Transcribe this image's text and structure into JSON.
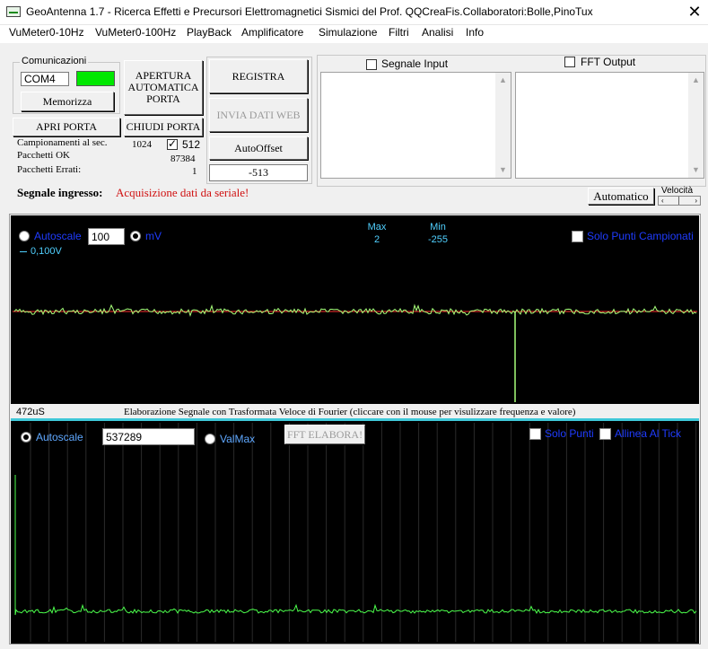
{
  "window": {
    "title": "GeoAntenna 1.7 - Ricerca Effetti e Precursori Elettromagnetici Sismici del Prof. QQCreaFis.Collaboratori:Bolle,PinoTux",
    "close_glyph": "✕"
  },
  "menu": [
    "VuMeter0-10Hz",
    "VuMeter0-100Hz",
    "PlayBack",
    "Amplificatore",
    "Simulazione",
    "Filtri",
    "Analisi",
    "Info"
  ],
  "comunicazioni": {
    "group_label": "Comunicazioni",
    "port_value": "COM4",
    "status_color": "#00e800",
    "memorizza_label": "Memorizza",
    "apri_porta_label": "APRI PORTA",
    "chiudi_porta_label": "CHIUDI PORTA",
    "apertura_line1": "APERTURA",
    "apertura_line2": "AUTOMATICA",
    "apertura_line3": "PORTA"
  },
  "stats": {
    "campionamenti_label": "Campionamenti al sec.",
    "campionamenti_value": "1024",
    "campionamenti_alt": "512",
    "pacchetti_ok_label": "Pacchetti OK",
    "pacchetti_ok_value": "87384",
    "pacchetti_errati_label": "Pacchetti Errati:",
    "pacchetti_errati_value": "1"
  },
  "actions": {
    "registra_label": "REGISTRA",
    "invia_label": "INVIA DATI WEB",
    "autooffset_label": "AutoOffset",
    "offset_value": "-513"
  },
  "panels": {
    "segnale_input_label": "Segnale Input",
    "fft_output_label": "FFT Output"
  },
  "segnale": {
    "label": "Segnale ingresso:",
    "status": "Acquisizione dati da seriale!",
    "automatico_label": "Automatico",
    "velocita_label": "Velocità"
  },
  "scope": {
    "autoscale_label": "Autoscale",
    "scale_value": "100",
    "unit_label": "mV",
    "max_label": "Max",
    "max_value": "2",
    "min_label": "Min",
    "min_value": "-255",
    "solo_punti_label": "Solo Punti Campionati",
    "grid_label": "0,100V",
    "time_label": "472uS"
  },
  "fft": {
    "caption": "Elaborazione Segnale con Trasformata Veloce di Fourier (cliccare con il mouse per visulizzare frequenza e valore)",
    "autoscale_label": "Autoscale",
    "value": "537289",
    "valmax_label": "ValMax",
    "elabora_label": "FFT ELABORA!",
    "solo_punti_label": "Solo Punti",
    "allinea_label": "Allinea Al Tick"
  },
  "colors": {
    "trace": "#a8ff7a",
    "baseline": "#ff3030",
    "fft_trace": "#4cff4c",
    "separator": "#3fc8d8",
    "status_red": "#d01010"
  }
}
